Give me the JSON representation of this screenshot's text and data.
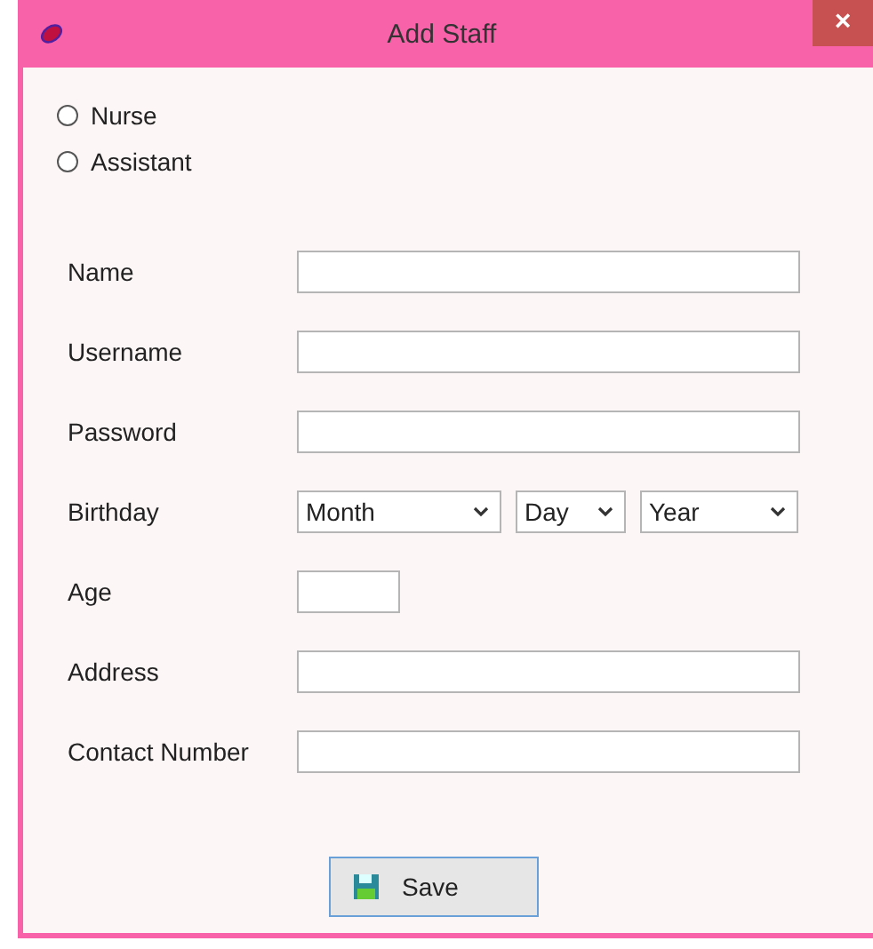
{
  "window": {
    "title": "Add Staff",
    "close": "×"
  },
  "role_options": [
    {
      "label": "Nurse",
      "selected": false
    },
    {
      "label": "Assistant",
      "selected": false
    }
  ],
  "fields": [
    {
      "kind": "text",
      "label": "Name"
    },
    {
      "kind": "text",
      "label": "Username"
    },
    {
      "kind": "text",
      "label": "Password"
    },
    {
      "kind": "date",
      "label": "Birthday",
      "dropdowns": [
        {
          "value": "Month"
        },
        {
          "value": "Day"
        },
        {
          "value": "Year"
        }
      ]
    },
    {
      "kind": "short",
      "label": "Age"
    },
    {
      "kind": "text",
      "label": "Address"
    },
    {
      "kind": "text",
      "label": "Contact Number"
    }
  ],
  "save_button": {
    "label": "Save"
  }
}
